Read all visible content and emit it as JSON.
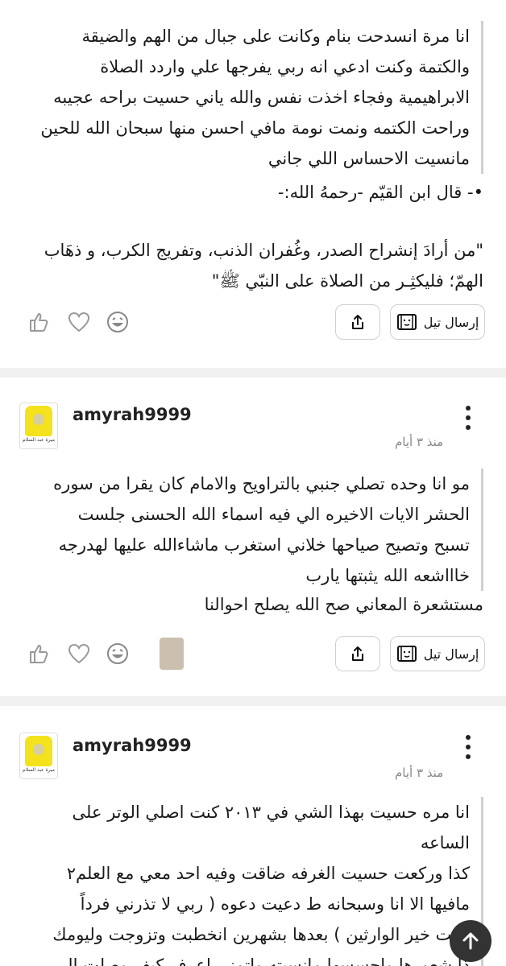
{
  "post1": {
    "quote": "انا مرة انسدحت بنام وكانت على جبال من الهم والضيقة\nوالكتمة وكنت ادعي انه ربي يفرجها علي واردد الصلاة\nالابراهيمية وفجاء اخذت نفس والله ياني حسيت براحه عجيبه\nوراحت الكتمه ونمت نومة مافي احسن منها سبحان الله للحين\nمانسيت الاحساس اللي جاني",
    "line2": "•- قال ابن القيّم -رحمهُ الله:-",
    "line3": "\"من أرادَ إنشراح الصدر، وغُفران الذنب، وتفريج الكرب، و ذهَاب\nالهمّ؛ فليكثِـر من الصلاة على النبّي ﷺ\""
  },
  "actions": {
    "send_label": "إرسال تيل",
    "icons": [
      "laugh-emoji-icon",
      "heart-icon",
      "thumbs-up-icon",
      "share-icon",
      "tell-icon"
    ]
  },
  "post2": {
    "username": "amyrah9999",
    "time": "منذ ٣ أيام",
    "avatar_caption": "ميرة عبد السلام",
    "quote": "مو انا وحده تصلي جنبي بالتراويح والامام كان يقرا من سوره\nالحشر الايات الاخيره الي فيه اسماء الله الحسنى جلست\nتسبح وتصيح صياحها خلاني استغرب ماشاءالله عليها لهدرجه\nخاااشعه الله يثبتها يارب",
    "reply": "مستشعرة المعاني صح الله يصلح احوالنا"
  },
  "post3": {
    "username": "amyrah9999",
    "time": "منذ ٣ أيام",
    "avatar_caption": "ميرة عبد السلام",
    "quote": "انا مره حسيت بهذا الشي في ٢٠١٣ كنت اصلي الوتر على الساعه\nكذا وركعت حسيت الغرفه ضاقت وفيه احد معي مع العلم٢\nمافيها الا انا وسبحانه ط دعيت دعوه ( ربي لا تذرني فرداً\nوانت خير الوارثين ) بعدها بشهرين انخطبت وتزوجت وليومك\nذا شعورها واحسسها مانسيته واتمنى اعرف كيف وصلت الى\nهالمرحله"
  }
}
